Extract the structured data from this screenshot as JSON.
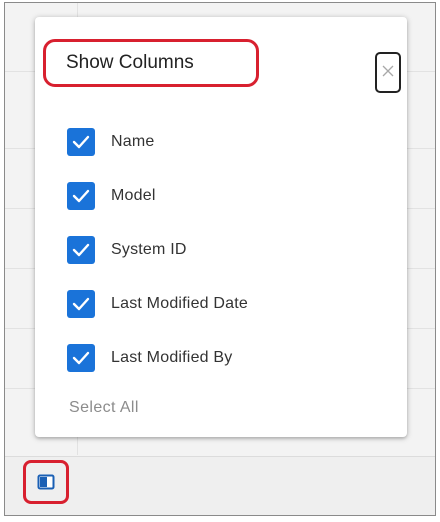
{
  "columns_panel": {
    "title": "Show Columns",
    "close_icon": "close-icon",
    "options": [
      {
        "label": "Name",
        "checked": true
      },
      {
        "label": "Model",
        "checked": true
      },
      {
        "label": "System ID",
        "checked": true
      },
      {
        "label": "Last Modified Date",
        "checked": true
      },
      {
        "label": "Last Modified By",
        "checked": true
      }
    ],
    "select_all_label": "Select All"
  },
  "footer": {
    "columns_toggle_icon": "columns-icon"
  },
  "colors": {
    "checkbox": "#1a73d9",
    "highlight": "#d8202f",
    "select_all": "#8c8c8c"
  }
}
